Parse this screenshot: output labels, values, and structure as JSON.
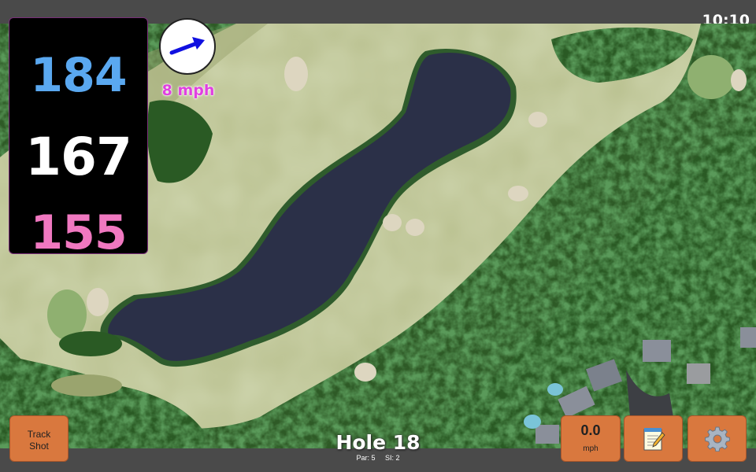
{
  "status_bar": {
    "time": "10:10"
  },
  "distances": {
    "back": "184",
    "middle": "167",
    "front": "155"
  },
  "wind": {
    "speed_label": "8 mph"
  },
  "hole": {
    "title": "Hole 18",
    "par": "Par: 5",
    "stroke_index": "SI: 2"
  },
  "buttons": {
    "track_shot_line1": "Track",
    "track_shot_line2": "Shot",
    "speed_value": "0.0",
    "speed_unit": "mph",
    "notes_icon": "notepad-icon",
    "settings_icon": "gear-icon"
  },
  "colors": {
    "back_distance": "#5aa8f0",
    "middle_distance": "#ffffff",
    "front_distance": "#f078c0",
    "wind_text": "#e040e0",
    "button_bg": "#d9783e"
  }
}
